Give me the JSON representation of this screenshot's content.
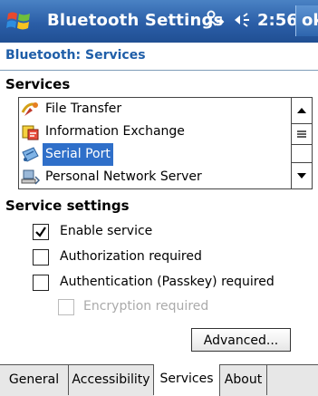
{
  "titlebar": {
    "title": "Bluetooth Settings",
    "time": "2:56",
    "ok_label": "ok"
  },
  "header": {
    "title": "Bluetooth: Services"
  },
  "services": {
    "label": "Services",
    "items": [
      {
        "label": "File Transfer",
        "icon": "file-transfer-icon",
        "selected": false
      },
      {
        "label": "Information Exchange",
        "icon": "information-exchange-icon",
        "selected": false
      },
      {
        "label": "Serial Port",
        "icon": "serial-port-icon",
        "selected": true
      },
      {
        "label": "Personal Network Server",
        "icon": "network-server-icon",
        "selected": false
      }
    ]
  },
  "service_settings": {
    "label": "Service settings",
    "enable_service": {
      "label": "Enable service",
      "checked": true
    },
    "authorization": {
      "label": "Authorization required",
      "checked": false
    },
    "authentication": {
      "label": "Authentication (Passkey) required",
      "checked": false
    },
    "encryption": {
      "label": "Encryption required",
      "checked": false,
      "disabled": true
    }
  },
  "advanced_button": "Advanced...",
  "tabs": [
    {
      "label": "General",
      "active": false
    },
    {
      "label": "Accessibility",
      "active": false
    },
    {
      "label": "Services",
      "active": true
    },
    {
      "label": "About",
      "active": false
    }
  ],
  "colors": {
    "selection": "#2f6fc9",
    "header_text": "#1f5ea8",
    "titlebar": "#2b5ea7"
  }
}
